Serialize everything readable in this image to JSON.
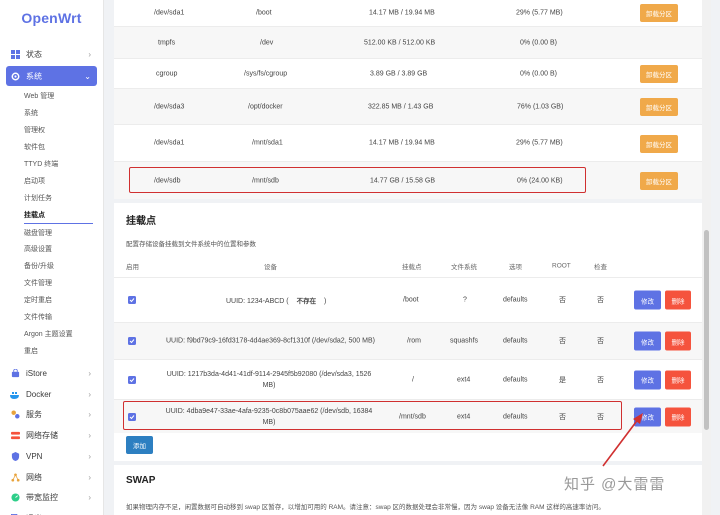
{
  "app": {
    "logo": "OpenWrt"
  },
  "sidebar": {
    "top_items": [
      {
        "label": "状态",
        "icon": "grid-icon"
      },
      {
        "label": "系统",
        "icon": "gear-icon"
      }
    ],
    "system_sub": [
      "Web 管理",
      "系统",
      "管理权",
      "软件包",
      "TTYD 终端",
      "启动项",
      "计划任务",
      "挂载点",
      "磁盘管理",
      "高级设置",
      "备份/升级",
      "文件管理",
      "定时重启",
      "文件传输",
      "Argon 主题设置",
      "重启"
    ],
    "bottom_items": [
      {
        "label": "iStore",
        "icon": "istore-icon"
      },
      {
        "label": "Docker",
        "icon": "docker-icon"
      },
      {
        "label": "服务",
        "icon": "services-icon"
      },
      {
        "label": "网络存储",
        "icon": "storage-icon"
      },
      {
        "label": "VPN",
        "icon": "vpn-icon"
      },
      {
        "label": "网络",
        "icon": "network-icon"
      },
      {
        "label": "带宽监控",
        "icon": "bandwidth-icon"
      },
      {
        "label": "退出",
        "icon": "logout-icon"
      }
    ]
  },
  "mounted": {
    "unmount_label": "卸载分区",
    "rows": [
      {
        "fs": "/dev/sda1",
        "mount": "/boot",
        "used": "14.17 MB / 19.94 MB",
        "avail": "29% (5.77 MB)",
        "unmount": true
      },
      {
        "fs": "tmpfs",
        "mount": "/dev",
        "used": "512.00 KB / 512.00 KB",
        "avail": "0% (0.00 B)",
        "unmount": false
      },
      {
        "fs": "cgroup",
        "mount": "/sys/fs/cgroup",
        "used": "3.89 GB / 3.89 GB",
        "avail": "0% (0.00 B)",
        "unmount": true
      },
      {
        "fs": "/dev/sda3",
        "mount": "/opt/docker",
        "used": "322.85 MB / 1.43 GB",
        "avail": "76% (1.03 GB)",
        "unmount": true
      },
      {
        "fs": "/dev/sda1",
        "mount": "/mnt/sda1",
        "used": "14.17 MB / 19.94 MB",
        "avail": "29% (5.77 MB)",
        "unmount": true
      },
      {
        "fs": "/dev/sdb",
        "mount": "/mnt/sdb",
        "used": "14.77 GB / 15.58 GB",
        "avail": "0% (24.00 KB)",
        "unmount": true
      }
    ]
  },
  "mountpoints": {
    "title": "挂载点",
    "desc": "配置存储设备挂载到文件系统中的位置和参数",
    "headers": [
      "启用",
      "设备",
      "挂载点",
      "文件系统",
      "选项",
      "ROOT",
      "检查"
    ],
    "edit_label": "修改",
    "delete_label": "删除",
    "add_label": "添加",
    "rows": [
      {
        "dev1": "UUID: 1234-ABCD (",
        "dev_tag": "不存在",
        "dev_end": ")",
        "dev2": "",
        "mount": "/boot",
        "fs": "?",
        "opts": "defaults",
        "root": "否",
        "check": "否"
      },
      {
        "dev1": "UUID: f9bd79c9-16fd3178-4d4ae369-8cf1310f (/dev/sda2, 500 MB)",
        "dev_tag": "",
        "dev_end": "",
        "dev2": "",
        "mount": "/rom",
        "fs": "squashfs",
        "opts": "defaults",
        "root": "否",
        "check": "否"
      },
      {
        "dev1": "UUID: 1217b3da-4d41-41df-9114-2945f5b92080 (/dev/sda3, 1526",
        "dev_tag": "",
        "dev_end": "",
        "dev2": "MB)",
        "mount": "/",
        "fs": "ext4",
        "opts": "defaults",
        "root": "是",
        "check": "否"
      },
      {
        "dev1": "UUID: 4dba9e47-33ae-4afa-9235-0c8b075aae62 (/dev/sdb, 16384",
        "dev_tag": "",
        "dev_end": "",
        "dev2": "MB)",
        "mount": "/mnt/sdb",
        "fs": "ext4",
        "opts": "defaults",
        "root": "否",
        "check": "否"
      }
    ]
  },
  "swap": {
    "title": "SWAP",
    "desc": "如果物理内存不足，闲置数据可自动移到 swap 区暂存，以增加可用的 RAM。请注意：swap 区的数据处理会非常慢，因为 swap 设备无法像 RAM 这样的高速率访问。"
  },
  "watermark": "知乎 @大雷雷",
  "colors": {
    "accent": "#5e72e4",
    "unmount": "#f0a94a",
    "delete": "#f5533d",
    "add": "#2d7fc1",
    "highlight": "#d03030"
  }
}
